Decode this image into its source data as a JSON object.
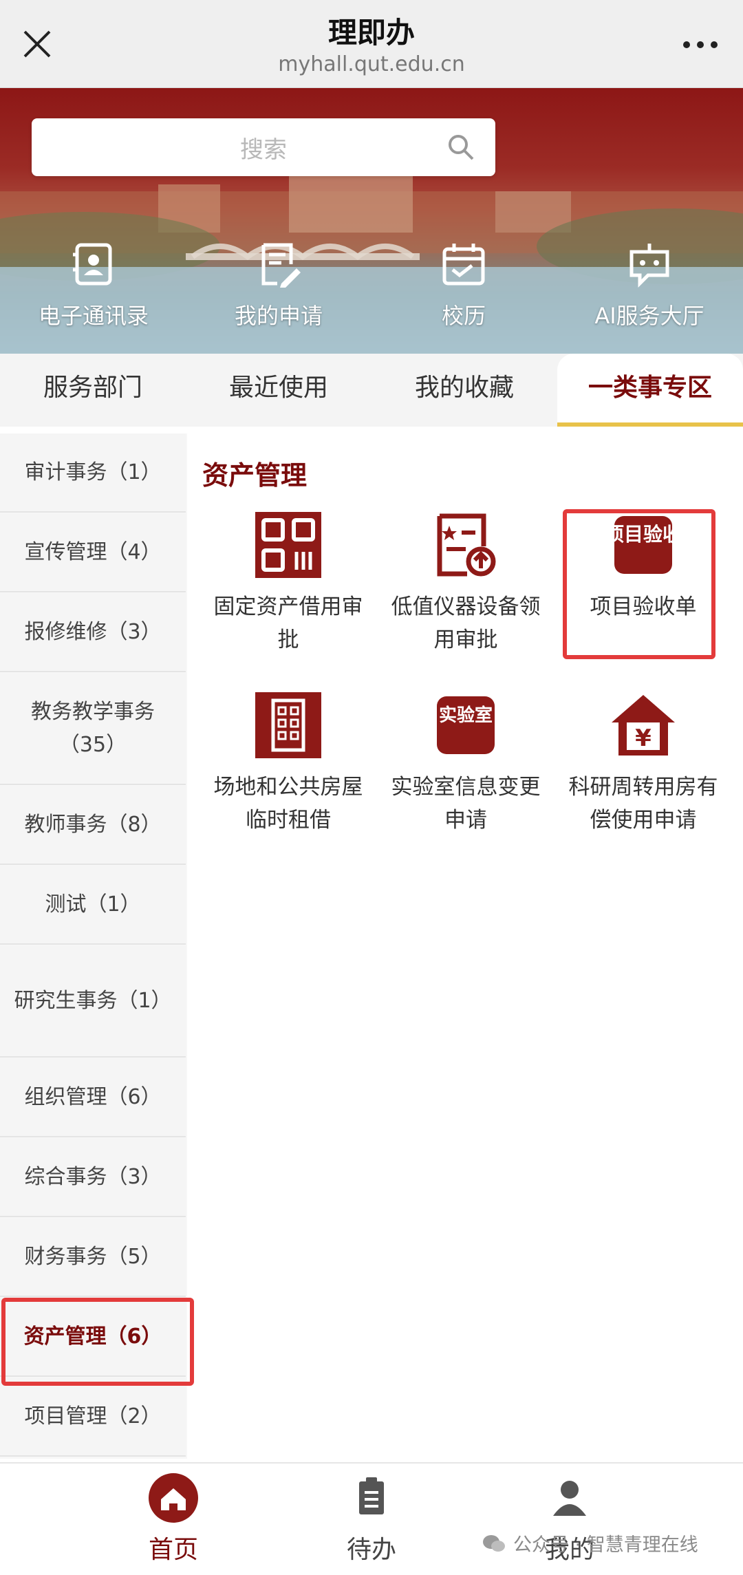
{
  "topbar": {
    "title": "理即办",
    "url": "myhall.qut.edu.cn"
  },
  "search": {
    "placeholder": "搜索"
  },
  "quick_links": [
    {
      "label": "电子通讯录",
      "icon": "contact-book-icon"
    },
    {
      "label": "我的申请",
      "icon": "application-edit-icon"
    },
    {
      "label": "校历",
      "icon": "calendar-icon"
    },
    {
      "label": "AI服务大厅",
      "icon": "robot-icon"
    }
  ],
  "tabs": [
    {
      "label": "服务部门"
    },
    {
      "label": "最近使用"
    },
    {
      "label": "我的收藏"
    },
    {
      "label": "一类事专区",
      "active": true
    }
  ],
  "sidebar": [
    {
      "label": "审计事务（1）"
    },
    {
      "label": "宣传管理（4）"
    },
    {
      "label": "报修维修（3）"
    },
    {
      "label": "教务教学事务（35）"
    },
    {
      "label": "教师事务（8）"
    },
    {
      "label": "测试（1）"
    },
    {
      "label": "研究生事务（1）"
    },
    {
      "label": "组织管理（6）"
    },
    {
      "label": "综合事务（3）"
    },
    {
      "label": "财务事务（5）"
    },
    {
      "label": "资产管理（6）",
      "active": true
    },
    {
      "label": "项目管理（2）"
    }
  ],
  "main": {
    "section_title": "资产管理",
    "items": [
      {
        "label": "固定资产借用审批",
        "icon": "qr-grid-icon"
      },
      {
        "label": "低值仪器设备领用审批",
        "icon": "document-upload-icon"
      },
      {
        "label": "项目验收单",
        "icon": "project-acceptance-icon",
        "icon_text": "项目验收"
      },
      {
        "label": "场地和公共房屋临时租借",
        "icon": "building-icon"
      },
      {
        "label": "实验室信息变更申请",
        "icon": "laboratory-icon",
        "icon_text": "实验室"
      },
      {
        "label": "科研周转用房有偿使用申请",
        "icon": "house-yuan-icon",
        "icon_text": "¥"
      }
    ]
  },
  "bottom_nav": [
    {
      "label": "首页",
      "icon": "home-icon",
      "active": true
    },
    {
      "label": "待办",
      "icon": "clipboard-icon"
    },
    {
      "label": "我的",
      "icon": "user-icon"
    }
  ],
  "watermark": {
    "text": "公众号 · 智慧青理在线"
  },
  "colors": {
    "brand": "#7a0c0c",
    "highlight": "#e33b3b",
    "tab_underline": "#e8c24a"
  }
}
